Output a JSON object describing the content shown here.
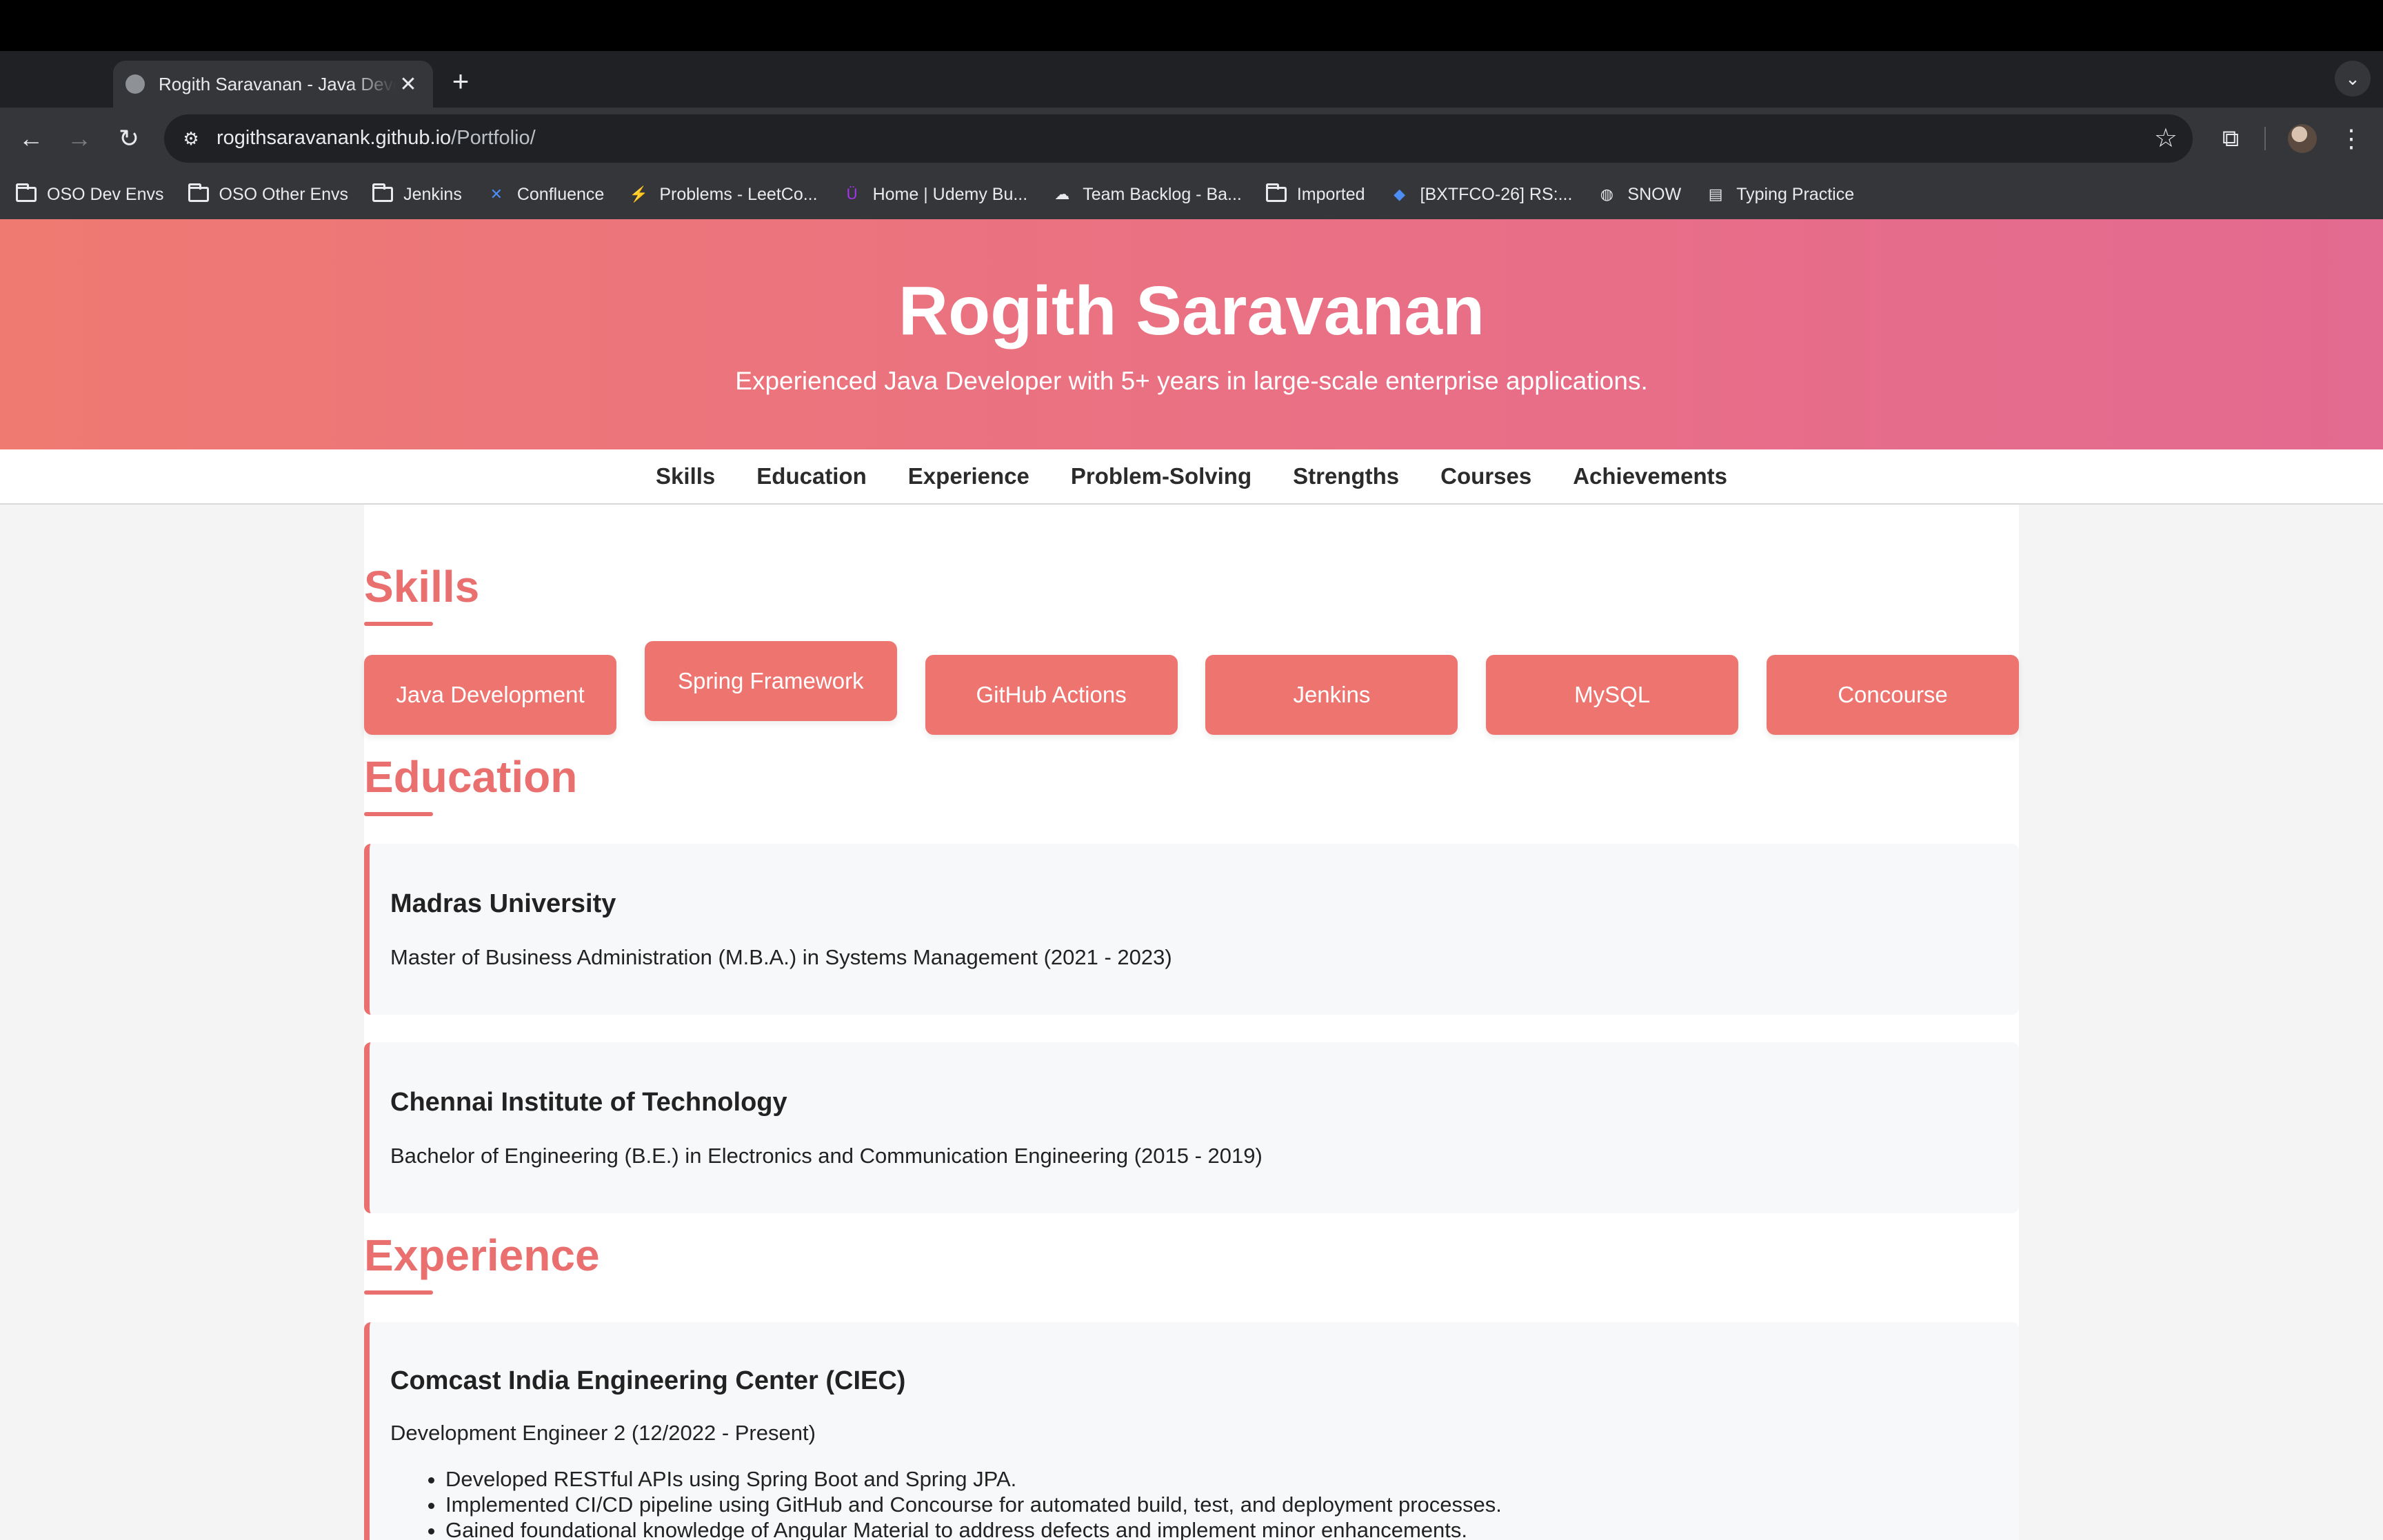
{
  "browser": {
    "tab_title": "Rogith Saravanan - Java Developer",
    "new_tab": "+",
    "url_host": "rogithsaravanank.github.io",
    "url_path": "/Portfolio/",
    "bookmarks": [
      {
        "label": "OSO Dev Envs",
        "icon": "folder-icon"
      },
      {
        "label": "OSO Other Envs",
        "icon": "folder-icon"
      },
      {
        "label": "Jenkins",
        "icon": "folder-icon"
      },
      {
        "label": "Confluence",
        "icon": "confluence-icon"
      },
      {
        "label": "Problems - LeetCo...",
        "icon": "leetcode-icon"
      },
      {
        "label": "Home | Udemy Bu...",
        "icon": "udemy-icon"
      },
      {
        "label": "Team Backlog - Ba...",
        "icon": "backlog-icon"
      },
      {
        "label": "Imported",
        "icon": "folder-icon"
      },
      {
        "label": "[BXTFCO-26] RS:...",
        "icon": "jira-icon"
      },
      {
        "label": "SNOW",
        "icon": "globe-icon"
      },
      {
        "label": "Typing Practice",
        "icon": "typing-icon"
      }
    ]
  },
  "hero": {
    "name": "Rogith Saravanan",
    "tagline": "Experienced Java Developer with 5+ years in large-scale enterprise applications."
  },
  "nav": [
    "Skills",
    "Education",
    "Experience",
    "Problem-Solving",
    "Strengths",
    "Courses",
    "Achievements"
  ],
  "skills": {
    "title": "Skills",
    "items": [
      "Java Development",
      "Spring Framework",
      "GitHub Actions",
      "Jenkins",
      "MySQL",
      "Concourse"
    ]
  },
  "education": {
    "title": "Education",
    "items": [
      {
        "school": "Madras University",
        "degree": "Master of Business Administration (M.B.A.) in Systems Management (2021 - 2023)"
      },
      {
        "school": "Chennai Institute of Technology",
        "degree": "Bachelor of Engineering (B.E.) in Electronics and Communication Engineering (2015 - 2019)"
      }
    ]
  },
  "experience": {
    "title": "Experience",
    "items": [
      {
        "company": "Comcast India Engineering Center (CIEC)",
        "role": "Development Engineer 2 (12/2022 - Present)",
        "bullets": [
          "Developed RESTful APIs using Spring Boot and Spring JPA.",
          "Implemented CI/CD pipeline using GitHub and Concourse for automated build, test, and deployment processes.",
          "Gained foundational knowledge of Angular Material to address defects and implement minor enhancements."
        ]
      }
    ]
  },
  "colors": {
    "accent": "#ea7070",
    "skill_bg": "#ee7470",
    "card_bg": "#f7f8f9",
    "chrome_dark": "#202124",
    "chrome": "#35363a"
  }
}
